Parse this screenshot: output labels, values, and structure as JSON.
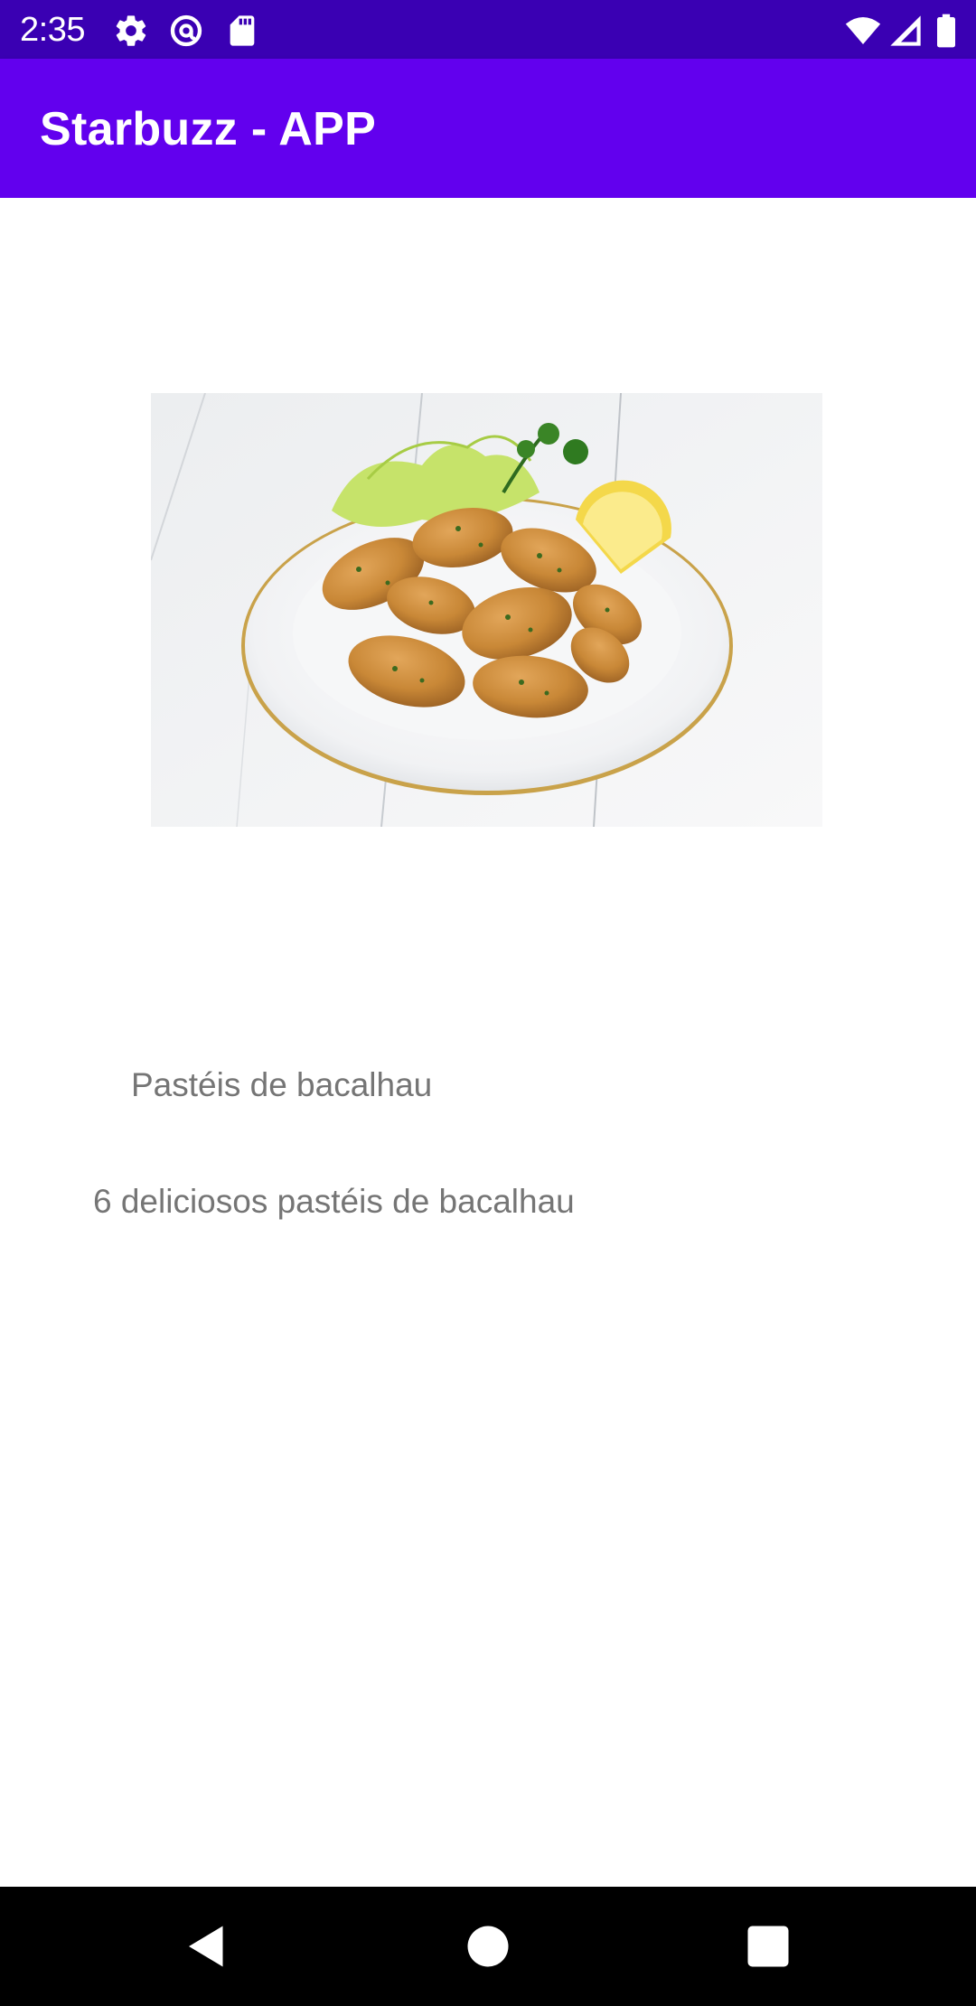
{
  "status_bar": {
    "time": "2:35",
    "left_icons": [
      "gear-icon",
      "at-sign-icon",
      "sd-card-icon"
    ],
    "right_icons": [
      "wifi-icon",
      "cell-signal-icon",
      "battery-icon"
    ]
  },
  "app_bar": {
    "title": "Starbuzz - APP",
    "color": "#6200ee"
  },
  "item": {
    "image": "food-photo",
    "name": "Pastéis de bacalhau",
    "description": "6 deliciosos pastéis de bacalhau"
  },
  "nav_bar": {
    "buttons": [
      "back-icon",
      "home-icon",
      "recents-icon"
    ]
  },
  "colors": {
    "status_bar": "#3a00b3",
    "primary": "#6200ee",
    "body_text": "#757575"
  }
}
